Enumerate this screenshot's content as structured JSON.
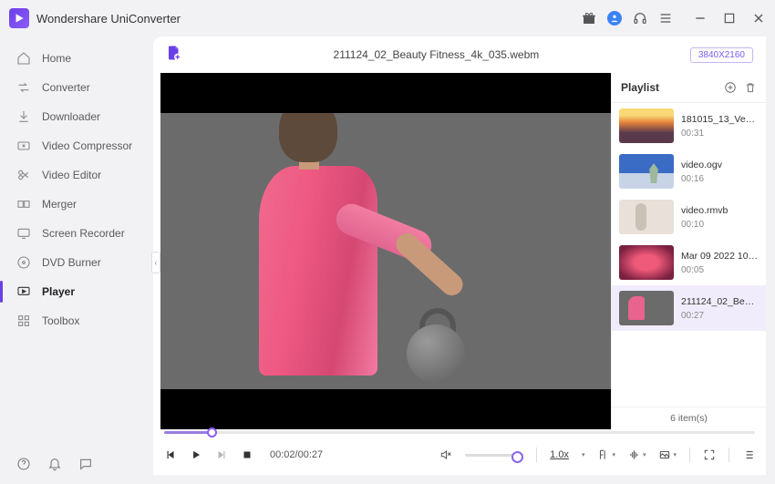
{
  "app": {
    "title": "Wondershare UniConverter"
  },
  "sidebar": {
    "items": [
      {
        "label": "Home"
      },
      {
        "label": "Converter"
      },
      {
        "label": "Downloader"
      },
      {
        "label": "Video Compressor"
      },
      {
        "label": "Video Editor"
      },
      {
        "label": "Merger"
      },
      {
        "label": "Screen Recorder"
      },
      {
        "label": "DVD Burner"
      },
      {
        "label": "Player"
      },
      {
        "label": "Toolbox"
      }
    ]
  },
  "player": {
    "file": "211124_02_Beauty Fitness_4k_035.webm",
    "resolution": "3840X2160",
    "time": "00:02/00:27",
    "rate": "1.0x"
  },
  "playlist": {
    "title": "Playlist",
    "items": [
      {
        "name": "181015_13_Venic...",
        "dur": "00:31"
      },
      {
        "name": "video.ogv",
        "dur": "00:16"
      },
      {
        "name": "video.rmvb",
        "dur": "00:10"
      },
      {
        "name": "Mar 09 2022 10_...",
        "dur": "00:05"
      },
      {
        "name": "211124_02_Beau...",
        "dur": "00:27"
      }
    ],
    "footer": "6 item(s)"
  }
}
